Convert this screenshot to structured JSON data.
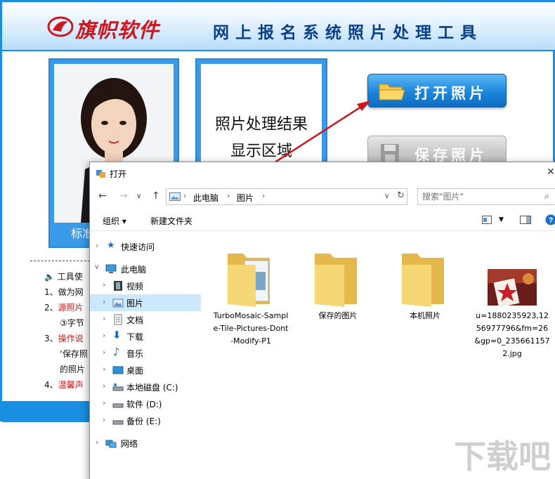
{
  "app": {
    "logo_text": "旗帜软件",
    "title": "网上报名系统照片处理工具",
    "photo_caption": "标准",
    "result_line1": "照片处理结果",
    "result_line2": "显示区域",
    "open_button": "打开照片",
    "save_button": "保存照片",
    "help": [
      {
        "text": "工具使"
      },
      {
        "text": "1、做为网"
      },
      {
        "text": "2、源照片",
        "red": "源照片"
      },
      {
        "text": "③字节"
      },
      {
        "text": "3、操作说",
        "red": "操作说"
      },
      {
        "text": "‘保存照"
      },
      {
        "text": "的照片"
      },
      {
        "text": "4、温馨声",
        "red": "温馨声"
      }
    ]
  },
  "dialog": {
    "title": "打开",
    "breadcrumb": [
      "此电脑",
      "图片"
    ],
    "search_placeholder": "搜索\"图片\"",
    "toolbar": {
      "organize": "组织 ▾",
      "new_folder": "新建文件夹"
    },
    "nav": [
      {
        "label": "快速访问",
        "icon": "star-icon"
      },
      {
        "label": "此电脑",
        "icon": "computer-icon"
      },
      {
        "label": "视频",
        "icon": "video-icon"
      },
      {
        "label": "图片",
        "icon": "pictures-icon"
      },
      {
        "label": "文档",
        "icon": "document-icon"
      },
      {
        "label": "下载",
        "icon": "download-icon"
      },
      {
        "label": "音乐",
        "icon": "music-icon"
      },
      {
        "label": "桌面",
        "icon": "desktop-icon"
      },
      {
        "label": "本地磁盘 (C:)",
        "icon": "drive-icon"
      },
      {
        "label": "软件 (D:)",
        "icon": "drive-icon"
      },
      {
        "label": "备份 (E:)",
        "icon": "drive-icon"
      },
      {
        "label": "网络",
        "icon": "network-icon"
      }
    ],
    "files": [
      {
        "name": "TurboMosaic-Sample-Tile-Pictures-Dont-Modify-P1",
        "type": "folder-with-files"
      },
      {
        "name": "保存的图片",
        "type": "folder"
      },
      {
        "name": "本机照片",
        "type": "folder"
      },
      {
        "name": "u=1880235923,1256977796&fm=26&gp=0_2356611572.jpg",
        "type": "image"
      }
    ]
  },
  "watermark": "下载吧"
}
